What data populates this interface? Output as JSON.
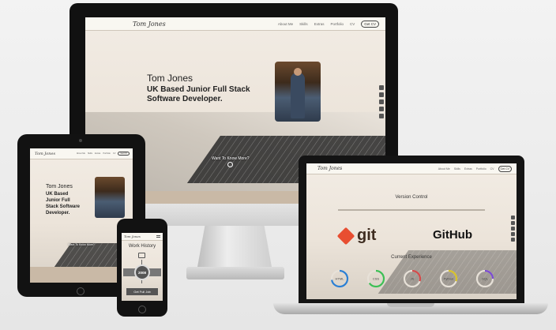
{
  "site": {
    "logo": "Tom Jones",
    "nav": [
      "About Me",
      "Skills",
      "Extras",
      "Portfolio",
      "CV"
    ],
    "cv_button": "Get CV",
    "hero": {
      "name": "Tom Jones",
      "tagline": "UK Based Junior Full Stack Software Developer.",
      "tagline_lines": [
        "UK Based Junior Full Stack",
        "Software Developer."
      ],
      "tagline_tablet": [
        "UK Based",
        "Junior Full",
        "Stack Software",
        "Developer."
      ]
    },
    "scroll_label": "Want To Know More?",
    "version_control": {
      "title": "Version Control",
      "git": "git",
      "github": "GitHub"
    },
    "current_experience": {
      "title": "Current Experience",
      "gauges": [
        {
          "label": "HTML",
          "percent": 0.72,
          "color": "#2a7fd4"
        },
        {
          "label": "CSS",
          "percent": 0.65,
          "color": "#3cbf55"
        },
        {
          "label": "JS",
          "percent": 0.3,
          "color": "#d24a4a"
        },
        {
          "label": "Python",
          "percent": 0.3,
          "color": "#d6c12a"
        },
        {
          "label": "SQL",
          "percent": 0.25,
          "color": "#7a4ad2"
        }
      ]
    },
    "work_history": {
      "title": "Work History",
      "year": "2008",
      "link": "Get Full Job"
    }
  },
  "colors": {
    "accent_red": "#e84e31",
    "badge_dark": "#555555"
  },
  "icons": [
    "facebook-icon",
    "linkedin-icon",
    "github-icon",
    "twitter-icon",
    "email-icon"
  ]
}
